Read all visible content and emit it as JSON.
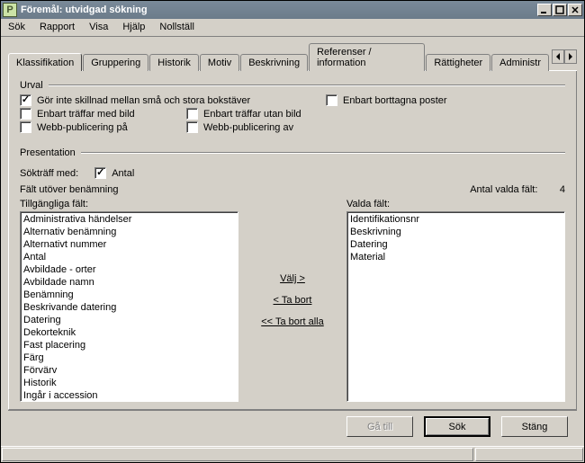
{
  "title": "Föremål: utvidgad sökning",
  "app_icon_char": "P",
  "menu": [
    "Sök",
    "Rapport",
    "Visa",
    "Hjälp",
    "Nollställ"
  ],
  "tabs": [
    "Klassifikation",
    "Gruppering",
    "Historik",
    "Motiv",
    "Beskrivning",
    "Referenser / information",
    "Rättigheter",
    "Administr"
  ],
  "active_tab_index": 0,
  "urval": {
    "label": "Urval",
    "checks": [
      {
        "label": "Gör inte skillnad mellan små och stora bokstäver",
        "checked": true
      },
      {
        "label": "Enbart borttagna poster",
        "checked": false
      },
      {
        "label": "Enbart träffar med bild",
        "checked": false
      },
      {
        "label": "Enbart träffar utan bild",
        "checked": false
      },
      {
        "label": "Webb-publicering på",
        "checked": false
      },
      {
        "label": "Webb-publicering av",
        "checked": false
      }
    ]
  },
  "presentation": {
    "label": "Presentation",
    "soktraff_label": "Sökträff med:",
    "antal": {
      "label": "Antal",
      "checked": true
    },
    "subheading": "Fält utöver benämning",
    "count_label": "Antal valda fält:",
    "count_value": "4"
  },
  "available": {
    "label": "Tillgängliga fält:",
    "items": [
      "Administrativa händelser",
      "Alternativ benämning",
      "Alternativt nummer",
      "Antal",
      "Avbildade - orter",
      "Avbildade namn",
      "Benämning",
      "Beskrivande datering",
      "Datering",
      "Dekorteknik",
      "Fast placering",
      "Färg",
      "Förvärv",
      "Historik",
      "Ingår i accession"
    ]
  },
  "selected": {
    "label": "Valda fält:",
    "items": [
      "Identifikationsnr",
      "Beskrivning",
      "Datering",
      "Material"
    ]
  },
  "actions": {
    "choose": "Välj >",
    "remove": "< Ta bort",
    "remove_all": "<< Ta bort alla"
  },
  "footer": {
    "goto": "Gå till",
    "search": "Sök",
    "close": "Stäng"
  }
}
